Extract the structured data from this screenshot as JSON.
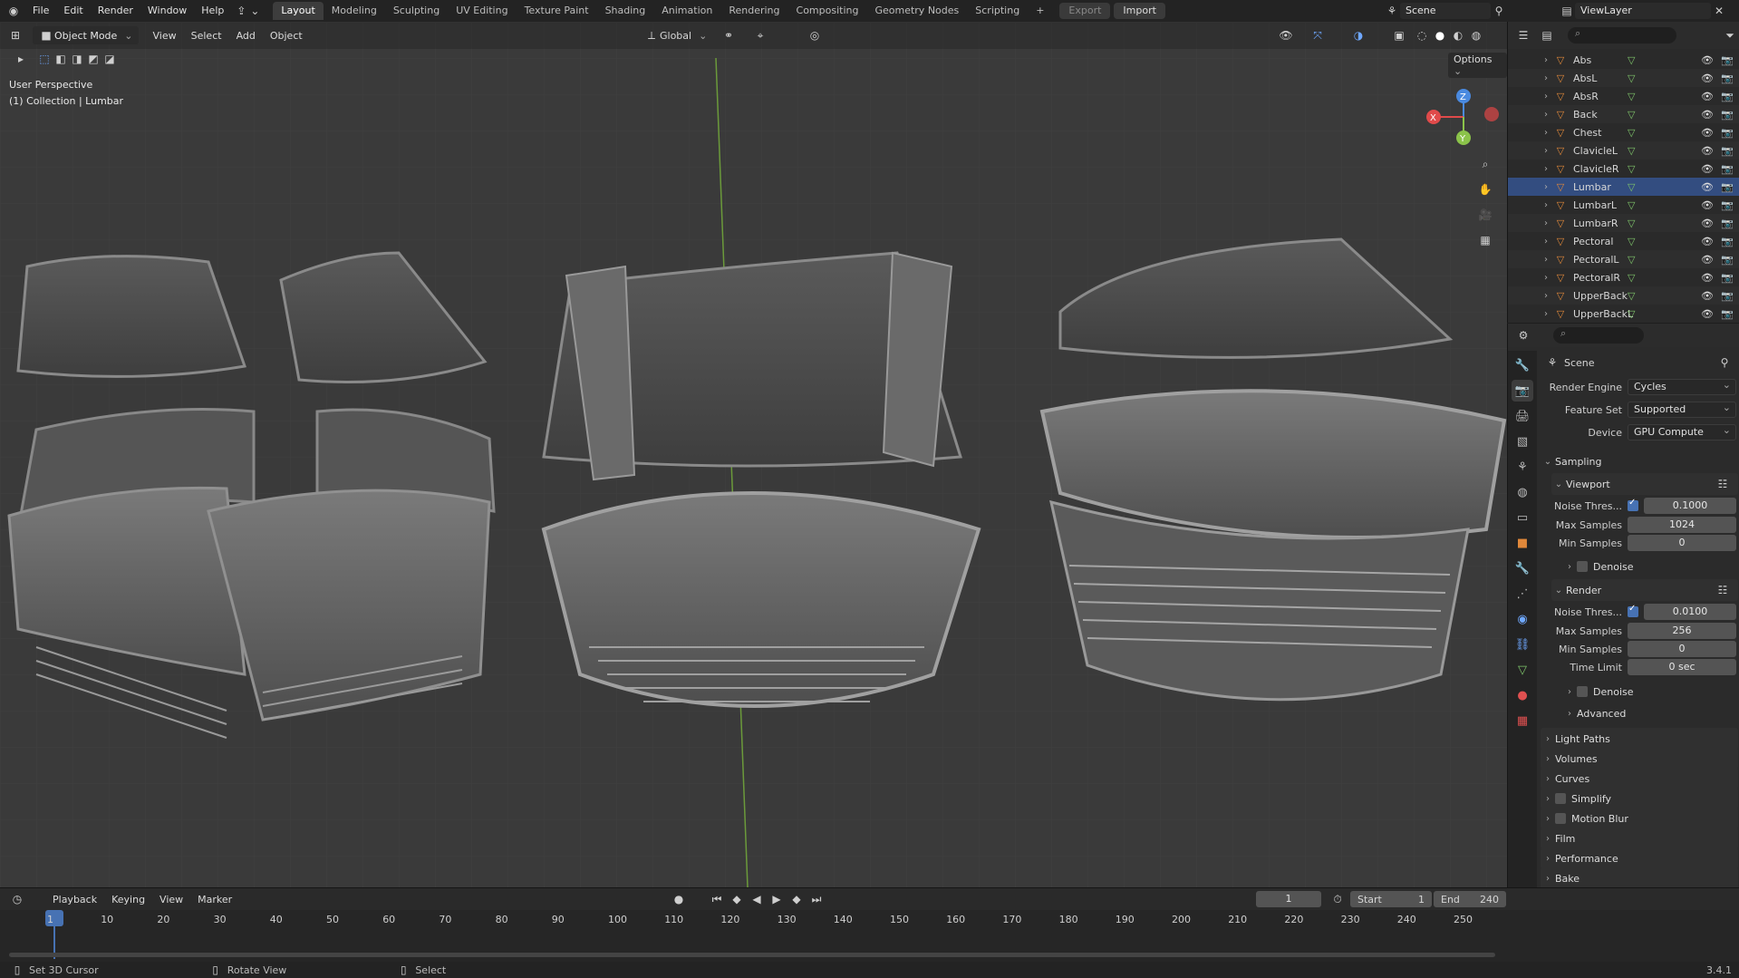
{
  "menu": {
    "items": [
      "File",
      "Edit",
      "Render",
      "Window",
      "Help"
    ],
    "workspaces": [
      "Layout",
      "Modeling",
      "Sculpting",
      "UV Editing",
      "Texture Paint",
      "Shading",
      "Animation",
      "Rendering",
      "Compositing",
      "Geometry Nodes",
      "Scripting"
    ],
    "active_workspace": "Layout",
    "export_label": "Export",
    "import_label": "Import",
    "scene_name": "Scene",
    "view_layer": "ViewLayer"
  },
  "viewport": {
    "mode": "Object Mode",
    "menus": [
      "View",
      "Select",
      "Add",
      "Object"
    ],
    "transform_orientation": "Global",
    "options_label": "Options",
    "perspective_label": "User Perspective",
    "collection_label": "(1) Collection | Lumbar",
    "gizmo": {
      "x": "X",
      "y": "Y",
      "z": "Z"
    }
  },
  "outliner": {
    "items": [
      {
        "name": "Abs",
        "selected": false
      },
      {
        "name": "AbsL",
        "selected": false
      },
      {
        "name": "AbsR",
        "selected": false
      },
      {
        "name": "Back",
        "selected": false
      },
      {
        "name": "Chest",
        "selected": false
      },
      {
        "name": "ClavicleL",
        "selected": false
      },
      {
        "name": "ClavicleR",
        "selected": false
      },
      {
        "name": "Lumbar",
        "selected": true
      },
      {
        "name": "LumbarL",
        "selected": false
      },
      {
        "name": "LumbarR",
        "selected": false
      },
      {
        "name": "Pectoral",
        "selected": false
      },
      {
        "name": "PectoralL",
        "selected": false
      },
      {
        "name": "PectoralR",
        "selected": false
      },
      {
        "name": "UpperBack",
        "selected": false
      },
      {
        "name": "UpperBackL",
        "selected": false
      }
    ]
  },
  "properties": {
    "context_title": "Scene",
    "render_engine": {
      "label": "Render Engine",
      "value": "Cycles"
    },
    "feature_set": {
      "label": "Feature Set",
      "value": "Supported"
    },
    "device": {
      "label": "Device",
      "value": "GPU Compute"
    },
    "sampling": {
      "title": "Sampling",
      "viewport": {
        "title": "Viewport",
        "noise_label": "Noise Thres...",
        "noise_value": "0.1000",
        "max_label": "Max Samples",
        "max_value": "1024",
        "min_label": "Min Samples",
        "min_value": "0",
        "denoise_label": "Denoise"
      },
      "render": {
        "title": "Render",
        "noise_label": "Noise Thres...",
        "noise_value": "0.0100",
        "max_label": "Max Samples",
        "max_value": "256",
        "min_label": "Min Samples",
        "min_value": "0",
        "time_label": "Time Limit",
        "time_value": "0 sec",
        "denoise_label": "Denoise"
      },
      "advanced_label": "Advanced"
    },
    "panels": [
      "Light Paths",
      "Volumes",
      "Curves",
      "Simplify",
      "Motion Blur",
      "Film",
      "Performance",
      "Bake"
    ]
  },
  "timeline": {
    "menus": [
      "Playback",
      "Keying",
      "View",
      "Marker"
    ],
    "current_frame": "1",
    "start_label": "Start",
    "start_value": "1",
    "end_label": "End",
    "end_value": "240",
    "ticks": [
      "1",
      "10",
      "20",
      "30",
      "40",
      "50",
      "60",
      "70",
      "80",
      "90",
      "100",
      "110",
      "120",
      "130",
      "140",
      "150",
      "160",
      "170",
      "180",
      "190",
      "200",
      "210",
      "220",
      "230",
      "240",
      "250"
    ]
  },
  "status": {
    "hint1": "Set 3D Cursor",
    "hint2": "Rotate View",
    "hint3": "Select",
    "version": "3.4.1"
  },
  "colors": {
    "accent": "#4772b3",
    "object_orange": "#e0883a",
    "mesh_green": "#7ec46a",
    "axis_x": "#e04a4a",
    "axis_y": "#8bc34a",
    "axis_z": "#4a8ae0"
  }
}
